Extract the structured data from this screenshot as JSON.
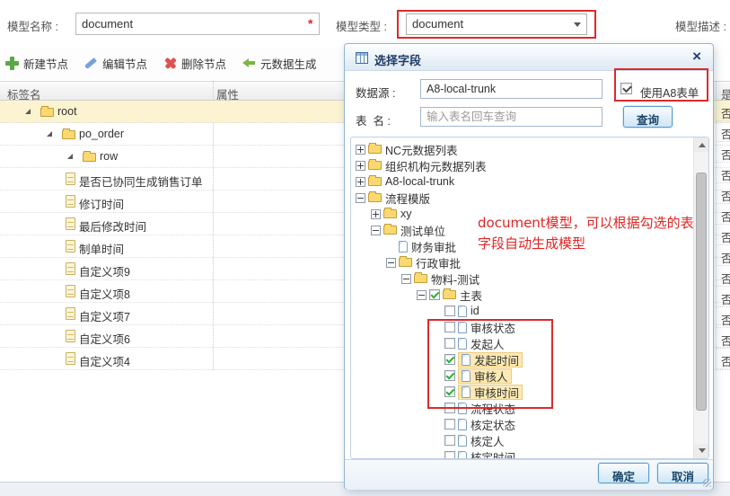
{
  "page": {
    "top_form": {
      "model_name_label": "模型名称 :",
      "model_name_value": "document",
      "required_marker": "*",
      "model_type_label": "模型类型 :",
      "model_type_value": "document",
      "model_desc_label": "模型描述 :"
    },
    "toolbar": {
      "items": [
        {
          "name": "new-node",
          "label": "新建节点",
          "icon": "plus-icon"
        },
        {
          "name": "edit-node",
          "label": "编辑节点",
          "icon": "pencil-icon"
        },
        {
          "name": "delete-node",
          "label": "删除节点",
          "icon": "delete-icon"
        },
        {
          "name": "metadata-generate",
          "label": "元数据生成",
          "icon": "arrow-left-icon"
        }
      ]
    },
    "table": {
      "headers": [
        "标签名",
        "属性"
      ],
      "rows": [
        {
          "label": "root",
          "type": "folder",
          "level": 0,
          "selected": true
        },
        {
          "label": "po_order",
          "type": "folder",
          "level": 1
        },
        {
          "label": "row",
          "type": "folder",
          "level": 2
        },
        {
          "label": "是否已协同生成销售订单",
          "type": "doc",
          "level": 3
        },
        {
          "label": "修订时间",
          "type": "doc",
          "level": 3
        },
        {
          "label": "最后修改时间",
          "type": "doc",
          "level": 3
        },
        {
          "label": "制单时间",
          "type": "doc",
          "level": 3
        },
        {
          "label": "自定义项9",
          "type": "doc",
          "level": 3
        },
        {
          "label": "自定义项8",
          "type": "doc",
          "level": 3
        },
        {
          "label": "自定义项7",
          "type": "doc",
          "level": 3
        },
        {
          "label": "自定义项6",
          "type": "doc",
          "level": 3
        },
        {
          "label": "自定义项4",
          "type": "doc",
          "level": 3
        }
      ]
    },
    "right_column": {
      "header": "是",
      "values": [
        "否",
        "否",
        "否",
        "否",
        "否",
        "否",
        "否",
        "否",
        "否",
        "否",
        "否",
        "否",
        "否"
      ]
    }
  },
  "dialog": {
    "title": "选择字段",
    "close_label": "×",
    "datasource_label": "数据源 :",
    "datasource_value": "A8-local-trunk",
    "use_a8_checkbox_label": "使用A8表单",
    "use_a8_checked": true,
    "table_name_label": "表  名 :",
    "table_name_placeholder": "输入表名回车查询",
    "search_button_label": "查询",
    "tree": [
      {
        "label": "NC元数据列表",
        "level": 0,
        "expander": "plus",
        "icon": "folder"
      },
      {
        "label": "组织机构元数据列表",
        "level": 0,
        "expander": "plus",
        "icon": "folder"
      },
      {
        "label": "A8-local-trunk",
        "level": 0,
        "expander": "plus",
        "icon": "folder"
      },
      {
        "label": "流程模版",
        "level": 0,
        "expander": "minus",
        "icon": "folder"
      },
      {
        "label": "xy",
        "level": 1,
        "expander": "plus",
        "icon": "folder"
      },
      {
        "label": "测试单位",
        "level": 1,
        "expander": "minus",
        "icon": "folder"
      },
      {
        "label": "财务审批",
        "level": 2,
        "expander": "none",
        "icon": "doc"
      },
      {
        "label": "行政审批",
        "level": 2,
        "expander": "minus",
        "icon": "folder"
      },
      {
        "label": "物料-测试",
        "level": 3,
        "expander": "minus",
        "icon": "folder"
      },
      {
        "label": "主表",
        "level": 4,
        "expander": "minus",
        "icon": "folder",
        "checkbox": "checked"
      },
      {
        "label": "id",
        "level": 5,
        "expander": "none",
        "icon": "doc",
        "checkbox": "unchecked"
      },
      {
        "label": "审核状态",
        "level": 5,
        "expander": "none",
        "icon": "doc",
        "checkbox": "unchecked"
      },
      {
        "label": "发起人",
        "level": 5,
        "expander": "none",
        "icon": "doc",
        "checkbox": "unchecked"
      },
      {
        "label": "发起时间",
        "level": 5,
        "expander": "none",
        "icon": "doc",
        "checkbox": "checked",
        "highlighted": true
      },
      {
        "label": "审核人",
        "level": 5,
        "expander": "none",
        "icon": "doc",
        "checkbox": "checked",
        "highlighted": true
      },
      {
        "label": "审核时间",
        "level": 5,
        "expander": "none",
        "icon": "doc",
        "checkbox": "checked",
        "highlighted": true
      },
      {
        "label": "流程状态",
        "level": 5,
        "expander": "none",
        "icon": "doc",
        "checkbox": "unchecked"
      },
      {
        "label": "核定状态",
        "level": 5,
        "expander": "none",
        "icon": "doc",
        "checkbox": "unchecked"
      },
      {
        "label": "核定人",
        "level": 5,
        "expander": "none",
        "icon": "doc",
        "checkbox": "unchecked"
      },
      {
        "label": "核定时间",
        "level": 5,
        "expander": "none",
        "icon": "doc",
        "checkbox": "unchecked"
      }
    ],
    "ok_button_label": "确定",
    "cancel_button_label": "取消"
  },
  "annotation": {
    "line1": "document模型，可以根据勾选的表",
    "line2": "字段自动生成模型"
  },
  "colors": {
    "annotation_red": "#e02525",
    "selection_row_yellow": "#fcf3d0",
    "checked_highlight": "#fde9b4",
    "check_green": "#2eb135",
    "dialog_border": "#94b3cf"
  }
}
